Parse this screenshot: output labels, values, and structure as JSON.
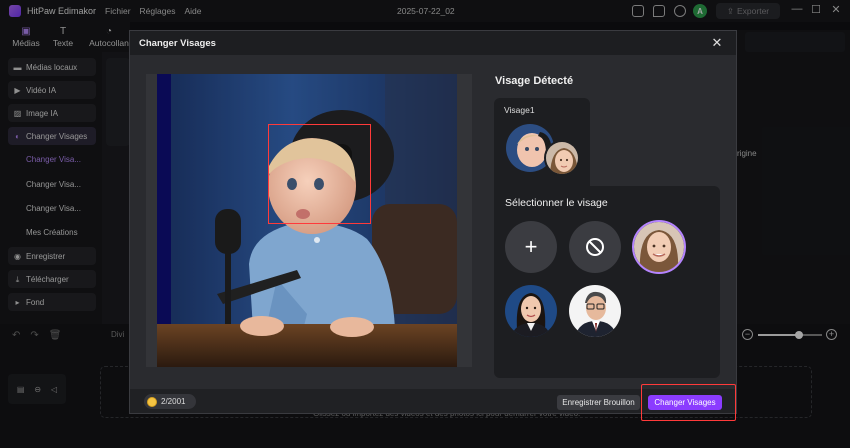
{
  "app": {
    "name": "HitPaw Edimakor",
    "menu": [
      "Fichier",
      "Réglages",
      "Aide"
    ],
    "project_title": "2025-07-22_02",
    "avatar_letter": "A",
    "export_label": "Exporter",
    "window_controls": {
      "minimize": "—",
      "maximize": "☐",
      "close": "✕"
    }
  },
  "tabs": [
    {
      "label": "Médias",
      "icon": "media-icon",
      "active": true
    },
    {
      "label": "Texte",
      "icon": "text-icon"
    },
    {
      "label": "Autocollan",
      "icon": "sticker-icon"
    }
  ],
  "sidebar": {
    "items": [
      {
        "label": "Médias locaux",
        "icon": "folder-icon"
      },
      {
        "label": "Vidéo IA",
        "icon": "ai-video-icon"
      },
      {
        "label": "Image IA",
        "icon": "ai-image-icon"
      },
      {
        "label": "Changer Visages",
        "icon": "face-swap-icon",
        "active": true
      }
    ],
    "subitems": [
      {
        "label": "Changer Visa...",
        "active": true
      },
      {
        "label": "Changer Visa..."
      },
      {
        "label": "Changer Visa..."
      },
      {
        "label": "Mes Créations"
      }
    ],
    "bottom_items": [
      {
        "label": "Enregistrer",
        "icon": "record-icon"
      },
      {
        "label": "Télécharger",
        "icon": "download-icon"
      },
      {
        "label": "Fond",
        "icon": "caret-right-icon"
      }
    ]
  },
  "right_panel": {
    "partial_label": "rigine"
  },
  "timeline": {
    "divide_label": "Divi",
    "drop_hint": "Glissez ou importez des vidéos et des photos ici pour démarrer votre vidéo.",
    "zoom_level": 0.62
  },
  "modal": {
    "title": "Changer Visages",
    "detected_title": "Visage Détecté",
    "face1_label": "Visage1",
    "select_title": "Sélectionner le visage",
    "add_symbol": "+",
    "credits": "2/2001",
    "save_draft": "Enregistrer Brouillon",
    "apply": "Changer Visages"
  },
  "colors": {
    "accent": "#8b3cff",
    "highlight": "#ff3a3a",
    "avatar": "#2ea44f"
  }
}
